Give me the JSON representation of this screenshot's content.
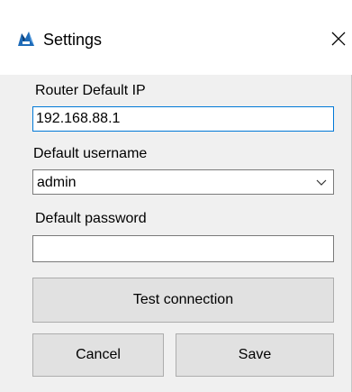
{
  "window": {
    "title": "Settings",
    "icon": "app-logo-icon",
    "close_icon": "close-icon"
  },
  "form": {
    "router_ip_label": "Router Default IP",
    "router_ip_value": "192.168.88.1",
    "username_label": "Default username",
    "username_value": "admin",
    "password_label": "Default password",
    "password_value": ""
  },
  "buttons": {
    "test_connection": "Test connection",
    "cancel": "Cancel",
    "save": "Save"
  },
  "colors": {
    "focus_border": "#0078d7",
    "button_bg": "#e1e1e1",
    "window_bg": "#f0f0f0"
  }
}
